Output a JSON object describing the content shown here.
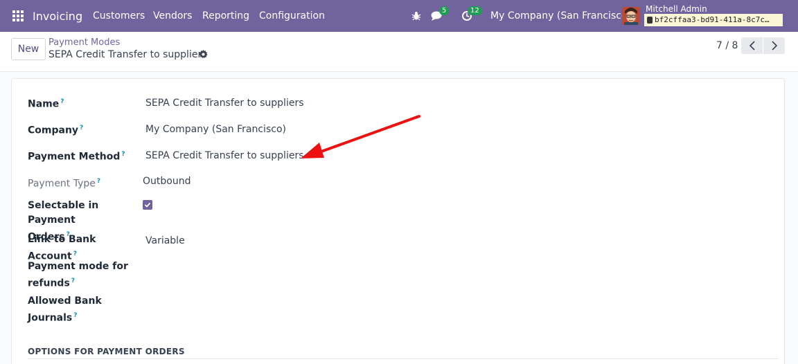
{
  "navbar": {
    "app_name": "Invoicing",
    "menu": [
      "Customers",
      "Vendors",
      "Reporting",
      "Configuration"
    ],
    "messages_count": "5",
    "activities_count": "12",
    "company": "My Company (San Francisco)",
    "user_name": "Mitchell Admin",
    "db_name": "bf2cffaa3-bd91-411a-8c7c…",
    "icons": [
      "apps-grid-icon",
      "bug-icon",
      "chat-icon",
      "clock-icon",
      "database-icon"
    ],
    "accent": "#71639e"
  },
  "control": {
    "new_label": "New",
    "breadcrumb_parent": "Payment Modes",
    "breadcrumb_current": "SEPA Credit Transfer to suppliers",
    "pager": "7 / 8"
  },
  "form": {
    "name_label": "Name",
    "name_value": "SEPA Credit Transfer to suppliers",
    "company_label": "Company",
    "company_value": "My Company (San Francisco)",
    "payment_method_label": "Payment Method",
    "payment_method_value": "SEPA Credit Transfer to suppliers",
    "payment_type_label": "Payment Type",
    "payment_type_value": "Outbound",
    "selectable_label_1": "Selectable in Payment",
    "selectable_label_2": "Orders",
    "selectable_checked": true,
    "link_bank_label": "Link to Bank Account",
    "link_bank_value": "Variable",
    "refund_label_1": "Payment mode for",
    "refund_label_2": "refunds",
    "journals_label_1": "Allowed Bank",
    "journals_label_2": "Journals",
    "help_marker": "?",
    "section_title": "OPTIONS FOR PAYMENT ORDERS"
  },
  "annotation": {
    "arrow_color": "#ee1111"
  }
}
